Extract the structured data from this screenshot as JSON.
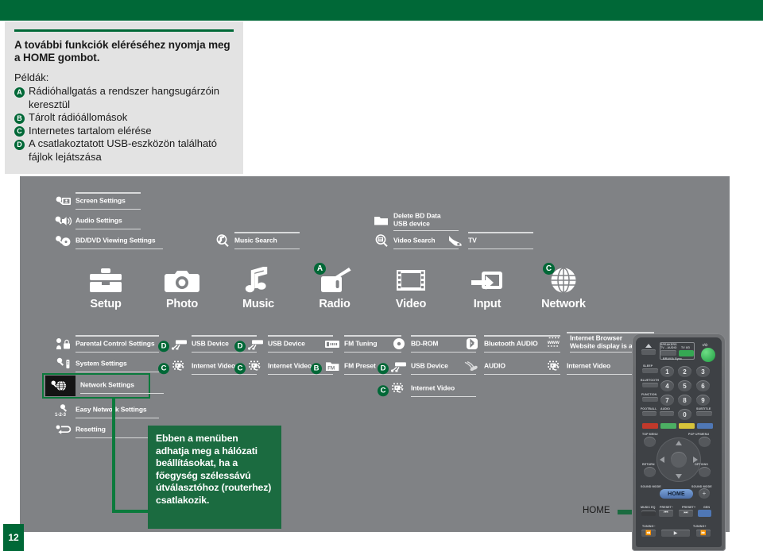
{
  "page": {
    "number": "12",
    "accent_green": "#006837",
    "panel_gray": "#808285",
    "callout_green": "#1b6b40"
  },
  "intro": {
    "title": "A további funkciók eléréséhez nyomja meg a HOME gombot.",
    "lead": "Példák:",
    "items": [
      {
        "badge": "A",
        "text": "Rádióhallgatás a rendszer hangsugárzóin keresztül"
      },
      {
        "badge": "B",
        "text": "Tárolt rádióállomások"
      },
      {
        "badge": "C",
        "text": "Internetes tartalom elérése"
      },
      {
        "badge": "D",
        "text": "A csatlakoztatott USB-eszközön található fájlok lejátszása"
      }
    ]
  },
  "top_menu": {
    "setup_column": [
      {
        "label": "Screen Settings",
        "icon": "screen-settings-icon"
      },
      {
        "label": "Audio Settings",
        "icon": "audio-settings-icon"
      },
      {
        "label": "BD/DVD Viewing Settings",
        "icon": "bd-dvd-viewing-settings-icon"
      }
    ],
    "music_column": [
      {
        "label": "Music Search",
        "icon": "music-search-icon"
      }
    ],
    "video_column": [
      {
        "label": "Delete BD Data\nUSB device",
        "icon": "folder-icon"
      },
      {
        "label": "Video Search",
        "icon": "video-search-icon"
      }
    ],
    "input_column": [
      {
        "label": "TV",
        "icon": "tv-input-icon"
      }
    ]
  },
  "categories": [
    {
      "label": "Setup",
      "icon": "toolbox-icon",
      "badge": ""
    },
    {
      "label": "Photo",
      "icon": "camera-icon",
      "badge": ""
    },
    {
      "label": "Music",
      "icon": "music-note-icon",
      "badge": ""
    },
    {
      "label": "Radio",
      "icon": "radio-icon",
      "badge": "A"
    },
    {
      "label": "Video",
      "icon": "film-icon",
      "badge": ""
    },
    {
      "label": "Input",
      "icon": "input-arrow-icon",
      "badge": ""
    },
    {
      "label": "Network",
      "icon": "globe-icon",
      "badge": "C"
    }
  ],
  "bottom_menu": {
    "setup": [
      {
        "label": "Parental Control Settings",
        "icon": "parental-control-icon",
        "badge": ""
      },
      {
        "label": "System Settings",
        "icon": "system-settings-icon",
        "badge": ""
      },
      {
        "label": "Network Settings",
        "icon": "network-settings-icon",
        "badge": "",
        "highlighted": true
      },
      {
        "label": "Easy Network Settings",
        "icon": "easy-network-icon",
        "badge": ""
      },
      {
        "label": "Resetting",
        "icon": "resetting-icon",
        "badge": ""
      }
    ],
    "photo": [
      {
        "label": "USB Device",
        "icon": "usb-device-icon",
        "badge": "D"
      },
      {
        "label": "Internet Video",
        "icon": "internet-video-icon",
        "badge": "C"
      }
    ],
    "music": [
      {
        "label": "USB Device",
        "icon": "usb-device-icon",
        "badge": "D"
      },
      {
        "label": "Internet Video",
        "icon": "internet-video-icon",
        "badge": "C"
      }
    ],
    "radio": [
      {
        "label": "FM Tuning",
        "icon": "fm-tuning-icon",
        "badge": ""
      },
      {
        "label": "FM Preset",
        "icon": "fm-preset-icon",
        "badge": "B"
      }
    ],
    "video": [
      {
        "label": "BD-ROM",
        "icon": "disc-icon",
        "badge": ""
      },
      {
        "label": "USB Device",
        "icon": "usb-device-icon",
        "badge": "D"
      },
      {
        "label": "Internet Video",
        "icon": "internet-video-icon",
        "badge": "C"
      }
    ],
    "input": [
      {
        "label": "Bluetooth AUDIO",
        "icon": "bluetooth-icon",
        "badge": ""
      },
      {
        "label": "AUDIO",
        "icon": "audio-cable-icon",
        "badge": ""
      }
    ],
    "network": [
      {
        "label": "Internet Browser\nWebsite display is available",
        "icon": "www-icon",
        "badge": ""
      },
      {
        "label": "Internet Video",
        "icon": "internet-video-icon",
        "badge": ""
      }
    ]
  },
  "callout": {
    "text": "Ebben a menüben adhatja meg a hálózati beállításokat, ha a főegység szélessávú útválasztóhoz (routerhez) csatlakozik."
  },
  "remote": {
    "home_pointer_label": "HOME",
    "home_button_label": "HOME",
    "labels": {
      "speakers": "SPEAKERS",
      "tv_audio": "TV↔AUDIO",
      "tv_power": "TV I/⏻",
      "power": "I/⏻",
      "bravia_sync": "BRAVIA Sync",
      "sleep": "SLEEP",
      "bluetooth": "BLUETOOTH",
      "function": "FUNCTION",
      "football": "FOOTBALL",
      "audio": "AUDIO",
      "subtitle": "SUBTITLE",
      "top_menu": "TOP MENU",
      "pop_up_menu": "POP UP/MENU",
      "return": "RETURN",
      "options": "OPTIONS",
      "sound_mode_l": "SOUND MODE",
      "sound_mode_r": "SOUND MODE",
      "music_eq": "MUSIC EQ",
      "preset_minus": "PRESET−",
      "preset_plus": "PRESET+",
      "gen": "GEN",
      "tuning_minus": "TUNING−",
      "tuning_plus": "TUNING+"
    },
    "numbers": [
      "1",
      "2",
      "3",
      "4",
      "5",
      "6",
      "7",
      "8",
      "9",
      "0"
    ]
  }
}
